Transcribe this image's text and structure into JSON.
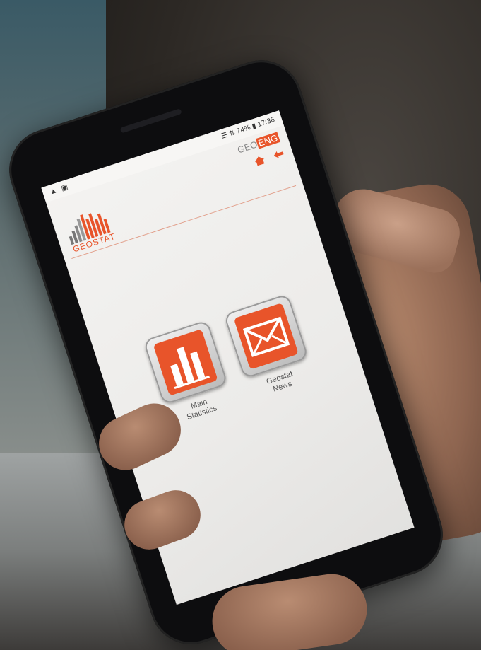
{
  "status_bar": {
    "left": "▲ ▣",
    "right": "☰ ⇅ 74% ▮ 17:36"
  },
  "header": {
    "lang_options": [
      "GEO",
      "ENG"
    ],
    "selected_lang": "ENG",
    "home_icon": "home-icon",
    "back_icon": "back-arrow-icon"
  },
  "logo": {
    "text": "GEOSTAT"
  },
  "menu": [
    {
      "label_line1": "Main",
      "label_line2": "Statistics",
      "icon": "bar-chart-icon"
    },
    {
      "label_line1": "Geostat",
      "label_line2": "News",
      "icon": "envelope-icon"
    }
  ],
  "colors": {
    "accent": "#e8542a",
    "screen_bg": "#efeeec"
  }
}
